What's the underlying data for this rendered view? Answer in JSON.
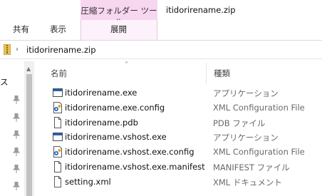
{
  "ribbon": {
    "context_group": "圧縮フォルダー ツール",
    "window_title": "itidorirename.zip",
    "tabs": [
      {
        "label": "共有"
      },
      {
        "label": "表示"
      },
      {
        "label": "展開"
      }
    ]
  },
  "address": {
    "path": "itidorirename.zip"
  },
  "nav": {
    "quick_access_fragment": "ス"
  },
  "list": {
    "columns": {
      "name": "名前",
      "type": "種類"
    },
    "files": [
      {
        "name": "itidorirename.exe",
        "type": "アプリケーション",
        "icon": "exe-icon"
      },
      {
        "name": "itidorirename.exe.config",
        "type": "XML Configuration File",
        "icon": "config-icon"
      },
      {
        "name": "itidorirename.pdb",
        "type": "PDB ファイル",
        "icon": "file-icon"
      },
      {
        "name": "itidorirename.vshost.exe",
        "type": "アプリケーション",
        "icon": "exe-icon"
      },
      {
        "name": "itidorirename.vshost.exe.config",
        "type": "XML Configuration File",
        "icon": "config-icon"
      },
      {
        "name": "itidorirename.vshost.exe.manifest",
        "type": "MANIFEST ファイル",
        "icon": "file-icon"
      },
      {
        "name": "setting.xml",
        "type": "XML ドキュメント",
        "icon": "file-icon"
      }
    ]
  },
  "colors": {
    "context_tab": "#f7d6ef",
    "exe_icon_bar": "#1f66b5"
  }
}
